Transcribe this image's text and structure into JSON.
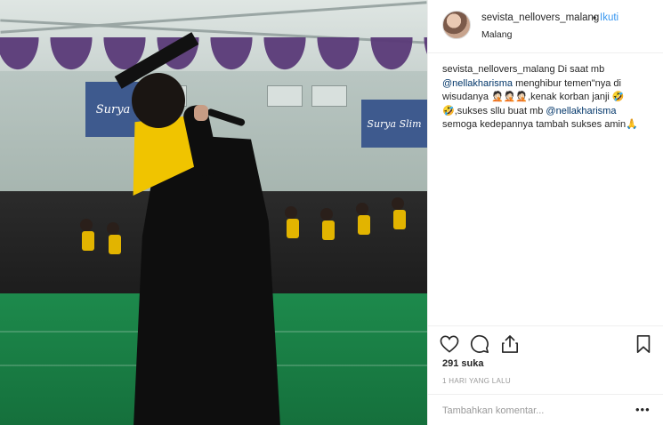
{
  "header": {
    "username": "sevista_nellovers_malang",
    "separator": "•",
    "follow_label": "Ikuti",
    "location": "Malang"
  },
  "caption": {
    "username": "sevista_nellovers_malang",
    "text_1": "Di saat mb",
    "mention_1": "@nellakharisma",
    "text_2": "menghibur temen\"nya di wisudanya 🤦🏻🤦🏻🤦🏻,kenak korban janji 🤣🤣,sukses sllu buat mb",
    "mention_2": "@nellakharisma",
    "text_3": "semoga kedepannya tambah sukses amin🙏"
  },
  "photo": {
    "banner_left": "Surya",
    "banner_right": "Surya Slim"
  },
  "actions": {
    "like_icon": "heart-icon",
    "comment_icon": "comment-icon",
    "share_icon": "share-icon",
    "save_icon": "bookmark-icon"
  },
  "likes": "291 suka",
  "timestamp": "1 HARI YANG LALU",
  "comment": {
    "placeholder": "Tambahkan komentar...",
    "more_label": "•••"
  },
  "colors": {
    "link_blue": "#3897f0",
    "mention_blue": "#003569",
    "border": "#efefef"
  }
}
